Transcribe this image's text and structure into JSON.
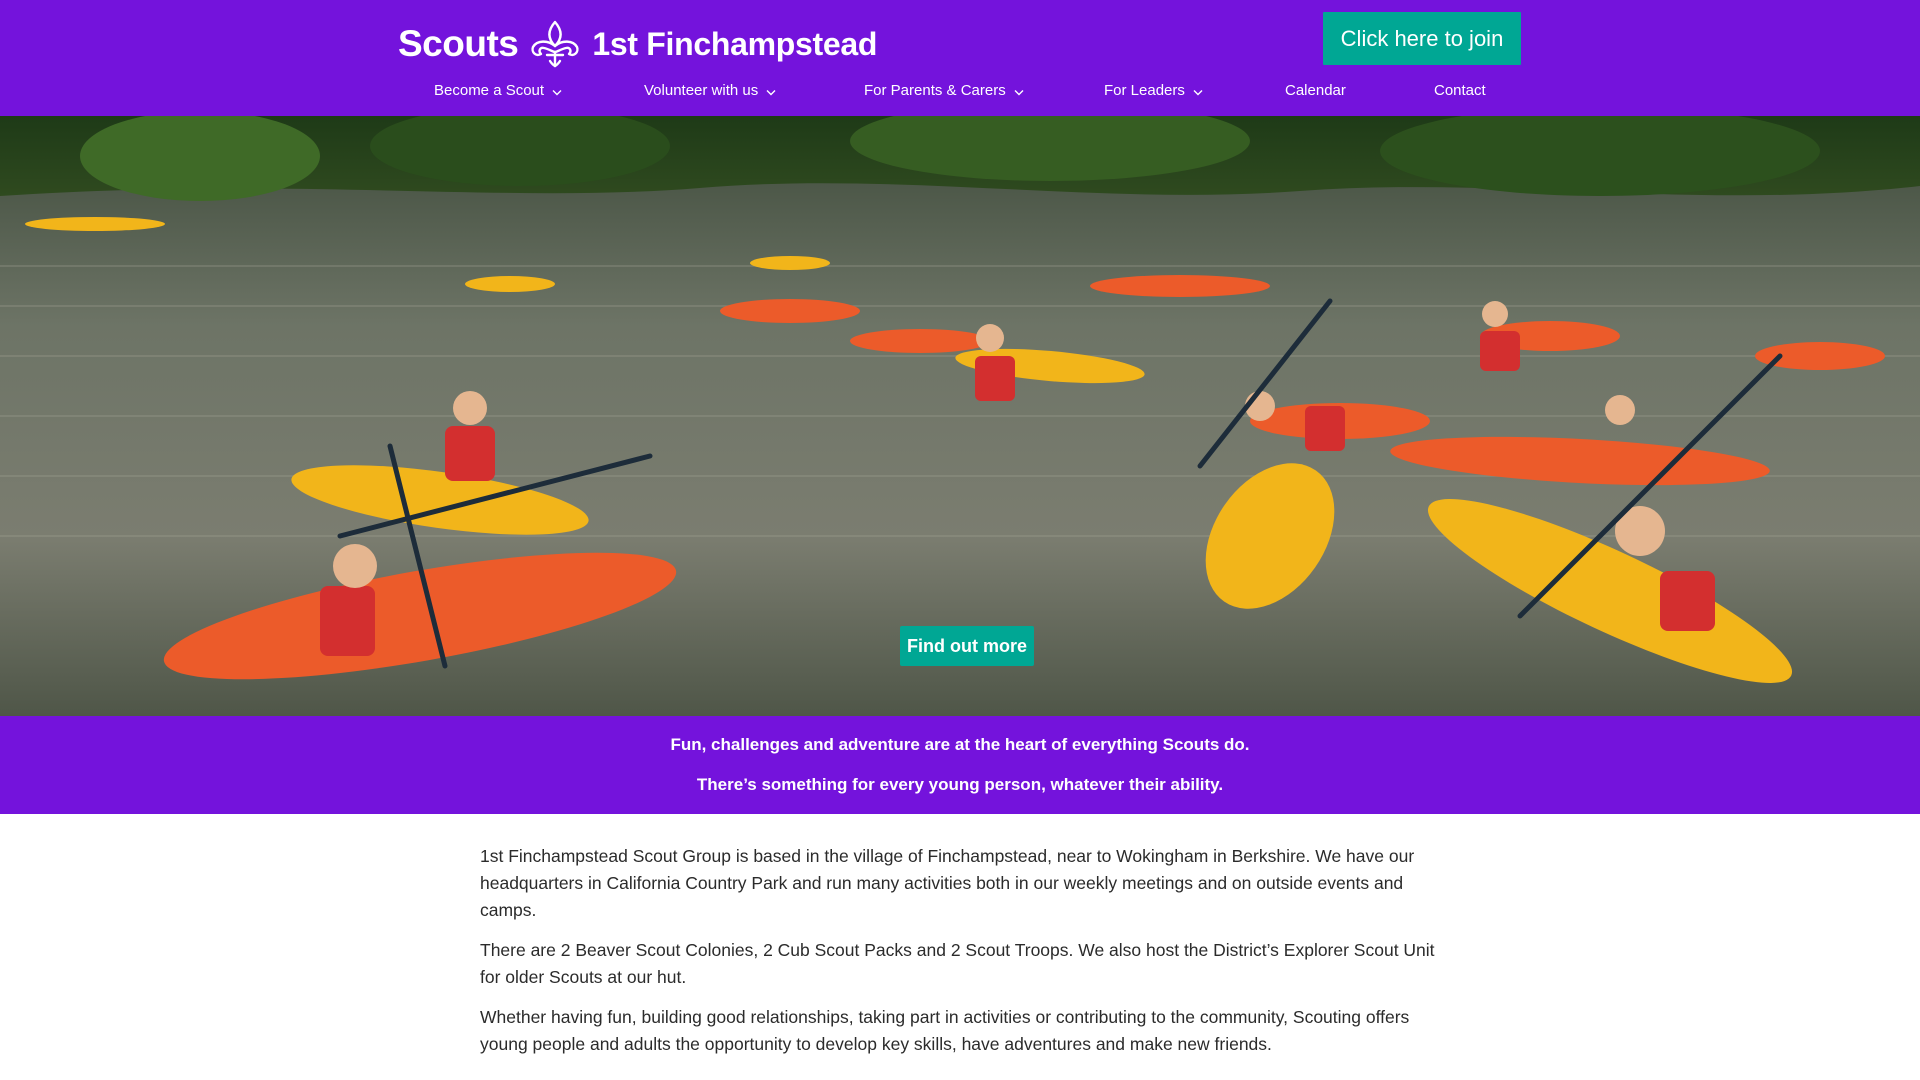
{
  "header": {
    "brand_word": "Scouts",
    "group_name": "1st Finchampstead",
    "logo_icon": "fleur-de-lis-icon",
    "join_label": "Click here to join"
  },
  "nav": {
    "items": [
      {
        "label": "Become a Scout",
        "has_dropdown": true
      },
      {
        "label": "Volunteer with us",
        "has_dropdown": true
      },
      {
        "label": "For Parents & Carers",
        "has_dropdown": true
      },
      {
        "label": "For Leaders",
        "has_dropdown": true
      },
      {
        "label": "Calendar",
        "has_dropdown": false
      },
      {
        "label": "Contact",
        "has_dropdown": false
      }
    ]
  },
  "hero": {
    "button_label": "Find out more"
  },
  "banner": {
    "line1": "Fun, challenges and adventure are at the heart of everything Scouts do.",
    "line2": "There’s something for every young person, whatever their ability."
  },
  "content": {
    "paragraphs": [
      "1st Finchampstead Scout Group is based in the village of Finchampstead, near to Wokingham in Berkshire. We have our headquarters in California Country Park and run many activities both in our weekly meetings and on outside events and camps.",
      "There are 2 Beaver Scout Colonies, 2 Cub Scout Packs and 2 Scout Troops. We also host the District’s Explorer Scout Unit for older Scouts at our hut.",
      "Whether having fun, building good relationships, taking part in activities or contributing to the community, Scouting offers young people and adults the opportunity to develop key skills, have adventures and make new friends."
    ]
  },
  "colors": {
    "brand_purple": "#7413dc",
    "teal": "#00a794",
    "white": "#ffffff"
  }
}
